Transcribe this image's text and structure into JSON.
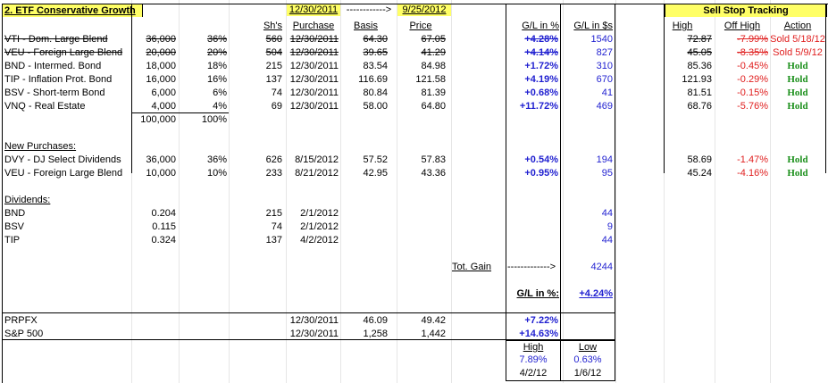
{
  "header": {
    "title": "2. ETF Conservative Growth",
    "start_date": "12/30/2011",
    "arrow": "------------>",
    "end_date": "9/25/2012",
    "col_shs": "Sh's",
    "col_purchase": "Purchase",
    "col_basis": "Basis",
    "col_price": "Price",
    "col_gl_pct": "G/L in %",
    "col_gl_usd": "G/L in $s"
  },
  "sell_stop": {
    "title": "Sell Stop Tracking",
    "col_high": "High",
    "col_off_high": "Off High",
    "col_action": "Action"
  },
  "holdings": [
    {
      "name": "VTI - Dom. Large Blend",
      "amount": "36,000",
      "pct": "36%",
      "shares": "560",
      "purchase": "12/30/2011",
      "basis": "64.30",
      "price": "67.05",
      "gl_pct": "+4.28%",
      "gl_usd": "1540",
      "high": "72.87",
      "off_high": "-7.99%",
      "action": "Sold 5/18/12"
    },
    {
      "name": "VEU - Foreign Large Blend",
      "amount": "20,000",
      "pct": "20%",
      "shares": "504",
      "purchase": "12/30/2011",
      "basis": "39.65",
      "price": "41.29",
      "gl_pct": "+4.14%",
      "gl_usd": "827",
      "high": "45.05",
      "off_high": "-8.35%",
      "action": "Sold 5/9/12"
    },
    {
      "name": "BND - Intermed. Bond",
      "amount": "18,000",
      "pct": "18%",
      "shares": "215",
      "purchase": "12/30/2011",
      "basis": "83.54",
      "price": "84.98",
      "gl_pct": "+1.72%",
      "gl_usd": "310",
      "high": "85.36",
      "off_high": "-0.45%",
      "action": "Hold"
    },
    {
      "name": "TIP - Inflation Prot. Bond",
      "amount": "16,000",
      "pct": "16%",
      "shares": "137",
      "purchase": "12/30/2011",
      "basis": "116.69",
      "price": "121.58",
      "gl_pct": "+4.19%",
      "gl_usd": "670",
      "high": "121.93",
      "off_high": "-0.29%",
      "action": "Hold"
    },
    {
      "name": "BSV - Short-term Bond",
      "amount": "6,000",
      "pct": "6%",
      "shares": "74",
      "purchase": "12/30/2011",
      "basis": "80.84",
      "price": "81.39",
      "gl_pct": "+0.68%",
      "gl_usd": "41",
      "high": "81.51",
      "off_high": "-0.15%",
      "action": "Hold"
    },
    {
      "name": "VNQ - Real Estate",
      "amount": "4,000",
      "pct": "4%",
      "shares": "69",
      "purchase": "12/30/2011",
      "basis": "58.00",
      "price": "64.80",
      "gl_pct": "+11.72%",
      "gl_usd": "469",
      "high": "68.76",
      "off_high": "-5.76%",
      "action": "Hold"
    }
  ],
  "totals": {
    "amount": "100,000",
    "pct": "100%"
  },
  "new_purchases": {
    "label": "New Purchases:",
    "rows": [
      {
        "name": "DVY - DJ Select Dividends",
        "amount": "36,000",
        "pct": "36%",
        "shares": "626",
        "purchase": "8/15/2012",
        "basis": "57.52",
        "price": "57.83",
        "gl_pct": "+0.54%",
        "gl_usd": "194",
        "high": "58.69",
        "off_high": "-1.47%",
        "action": "Hold"
      },
      {
        "name": "VEU - Foreign Large Blend",
        "amount": "10,000",
        "pct": "10%",
        "shares": "233",
        "purchase": "8/21/2012",
        "basis": "42.95",
        "price": "43.36",
        "gl_pct": "+0.95%",
        "gl_usd": "95",
        "high": "45.24",
        "off_high": "-4.16%",
        "action": "Hold"
      }
    ]
  },
  "dividends": {
    "label": "Dividends:",
    "rows": [
      {
        "name": "BND",
        "amount": "0.204",
        "shares": "215",
        "date": "2/1/2012",
        "gl_usd": "44"
      },
      {
        "name": "BSV",
        "amount": "0.115",
        "shares": "74",
        "date": "2/1/2012",
        "gl_usd": "9"
      },
      {
        "name": "TIP",
        "amount": "0.324",
        "shares": "137",
        "date": "4/2/2012",
        "gl_usd": "44"
      }
    ]
  },
  "summary": {
    "tot_gain_label": "Tot. Gain",
    "tot_gain_arrow": "------------->",
    "tot_gain": "4244",
    "gl_pct_label": "G/L in %:",
    "gl_pct": "+4.24%"
  },
  "benchmarks": [
    {
      "name": "PRPFX",
      "purchase": "12/30/2011",
      "basis": "46.09",
      "price": "49.42",
      "gl_pct": "+7.22%"
    },
    {
      "name": "S&P 500",
      "purchase": "12/30/2011",
      "basis": "1,258",
      "price": "1,442",
      "gl_pct": "+14.63%"
    }
  ],
  "high_low": {
    "high_label": "High",
    "low_label": "Low",
    "high_pct": "7.89%",
    "low_pct": "0.63%",
    "high_date": "4/2/12",
    "low_date": "1/6/12"
  },
  "colors": {
    "highlight": "#ffff66",
    "blue": "#1f1fd0",
    "red": "#e02020",
    "green": "#1a8f1a"
  }
}
